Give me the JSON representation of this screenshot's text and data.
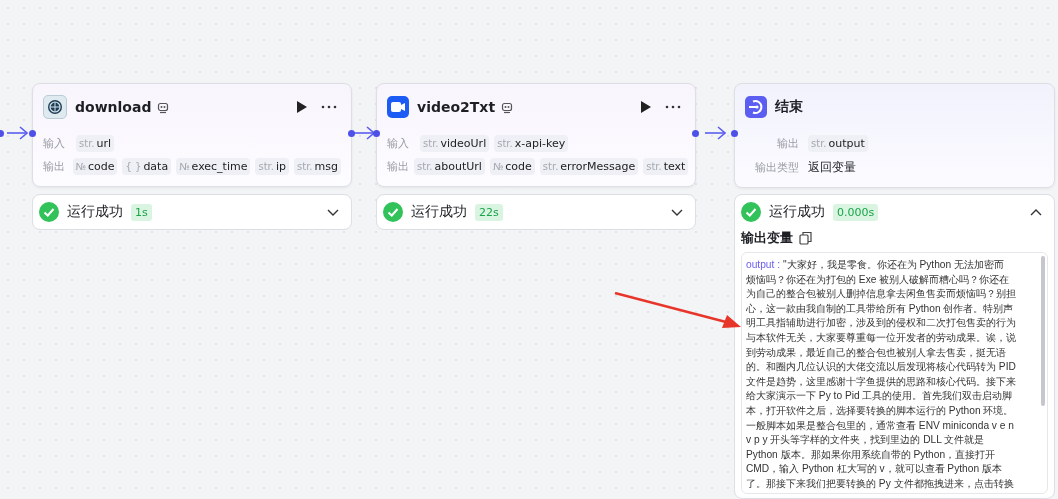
{
  "nodes": [
    {
      "kind": "tool",
      "title": "download",
      "inputs_label": "输入",
      "inputs": [
        {
          "type": "str.",
          "name": "url"
        }
      ],
      "outputs_label": "输出",
      "outputs": [
        {
          "type": "№",
          "name": "code"
        },
        {
          "type": "{ }",
          "name": "data"
        },
        {
          "type": "№",
          "name": "exec_time"
        },
        {
          "type": "str.",
          "name": "ip"
        },
        {
          "type": "str.",
          "name": "msg"
        }
      ],
      "status": {
        "label": "运行成功",
        "time": "1s",
        "expanded": false
      }
    },
    {
      "kind": "tool",
      "title": "video2Txt",
      "inputs_label": "输入",
      "inputs": [
        {
          "type": "str.",
          "name": "videoUrl"
        },
        {
          "type": "str.",
          "name": "x-api-key"
        }
      ],
      "outputs_label": "输出",
      "outputs": [
        {
          "type": "str.",
          "name": "aboutUrl"
        },
        {
          "type": "№",
          "name": "code"
        },
        {
          "type": "str.",
          "name": "errorMessage"
        },
        {
          "type": "str.",
          "name": "text"
        }
      ],
      "status": {
        "label": "运行成功",
        "time": "22s",
        "expanded": false
      }
    },
    {
      "kind": "end",
      "title": "结束",
      "outputs_label": "输出",
      "outputs": [
        {
          "type": "str.",
          "name": "output"
        }
      ],
      "output_type_label": "输出类型",
      "output_type": "返回变量",
      "status": {
        "label": "运行成功",
        "time": "0.000s",
        "expanded": true,
        "result_title": "输出变量",
        "result_key": "output :",
        "result_lines": [
          "\"大家好，我是零食。你还在为 Python 无法加密而",
          "烦恼吗？你还在为打包的 Exe 被别人破解而糟心吗？你还在",
          "为自己的整合包被别人删掉信息拿去闲鱼售卖而烦恼吗？别担",
          "心，这一款由我自制的工具带给所有 Python 创作者。特别声",
          "明工具指辅助进行加密，涉及到的侵权和二次打包售卖的行为",
          "与本软件无关，大家要尊重每一位开发者的劳动成果。诶，说",
          "到劳动成果，最近自己的整合包也被别人拿去售卖，挺无语",
          "的。和圈内几位认识的大佬交流以后发现将核心代码转为 PID",
          "文件是趋势，这里感谢十字鱼提供的思路和核心代码。接下来",
          "给大家演示一下 Py to Pid 工具的使用。首先我们双击启动脚",
          "本，打开软件之后，选择要转换的脚本运行的 Python 环境。",
          "一般脚本如果是整合包里的，通常查看 ENV miniconda v e n",
          "v p y 开头等字样的文件夹，找到里边的 DLL 文件就是",
          "Python 版本。那如果你用系统自带的 Python，直接打开",
          "CMD，输入 Python 杠大写的 v，就可以查看 Python 版本",
          "了。那接下来我们把要转换的 Py 文件都拖拽进来，点击转换"
        ]
      }
    }
  ]
}
